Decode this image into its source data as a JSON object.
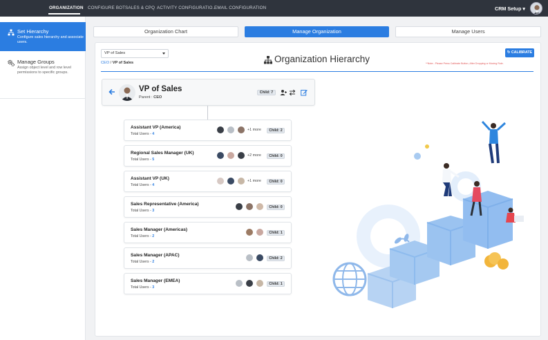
{
  "topnav": {
    "items": [
      {
        "label": "ORGANIZATION",
        "active": true
      },
      {
        "label": "CONFIGURE BOT"
      },
      {
        "label": "SALES & CPQ"
      },
      {
        "label": "ACTIVITY CONFIGURATIO..."
      },
      {
        "label": "EMAIL CONFIGURATION"
      }
    ],
    "app_menu": "CRM Setup ▾"
  },
  "sidebar": {
    "items": [
      {
        "title": "Set Hierarchy",
        "description": "Configure sales hierarchy and associate users.",
        "active": true
      },
      {
        "title": "Manage Groups",
        "description": "Assign object level and row level permissions to specific groups."
      }
    ]
  },
  "tabs": [
    {
      "label": "Organization Chart"
    },
    {
      "label": "Manage Organization",
      "active": true
    },
    {
      "label": "Manage Users"
    }
  ],
  "panel": {
    "select_value": "VP of Sales",
    "breadcrumb": {
      "link": "CEO",
      "sep": " / ",
      "current": "VP of Sales"
    },
    "heading": "Organization Hierarchy",
    "calibrate_label": "CALIBRATE",
    "note": "**Note:- Please Press Calibrate Button, After Dropping or Moving Role."
  },
  "root": {
    "name": "VP of Sales",
    "parent_label": "Parent : ",
    "parent": "CEO",
    "child_badge": "Child: 7"
  },
  "children": [
    {
      "name": "Assistant VP (America)",
      "users_label": "Total Users - ",
      "users": "4",
      "more": "+1 more",
      "child_badge": "Child: 2"
    },
    {
      "name": "Regional Sales Manager (UK)",
      "users_label": "Total Users - ",
      "users": "5",
      "more": "+2 more",
      "child_badge": "Child: 0"
    },
    {
      "name": "Assistant VP (UK)",
      "users_label": "Total Users - ",
      "users": "4",
      "more": "+1 more",
      "child_badge": "Child: 0"
    },
    {
      "name": "Sales Representative (America)",
      "users_label": "Total Users - ",
      "users": "3",
      "more": "",
      "child_badge": "Child: 0"
    },
    {
      "name": "Sales Manager (Americas)",
      "users_label": "Total Users - ",
      "users": "2",
      "more": "",
      "child_badge": "Child: 1"
    },
    {
      "name": "Sales Manager (APAC)",
      "users_label": "Total Users - ",
      "users": "2",
      "more": "",
      "child_badge": "Child: 2"
    },
    {
      "name": "Sales Manager (EMEA)",
      "users_label": "Total Users - ",
      "users": "3",
      "more": "",
      "child_badge": "Child: 1"
    }
  ],
  "colors": {
    "accent": "#2b7de1",
    "nav": "#2f343d",
    "note": "#e05555"
  }
}
